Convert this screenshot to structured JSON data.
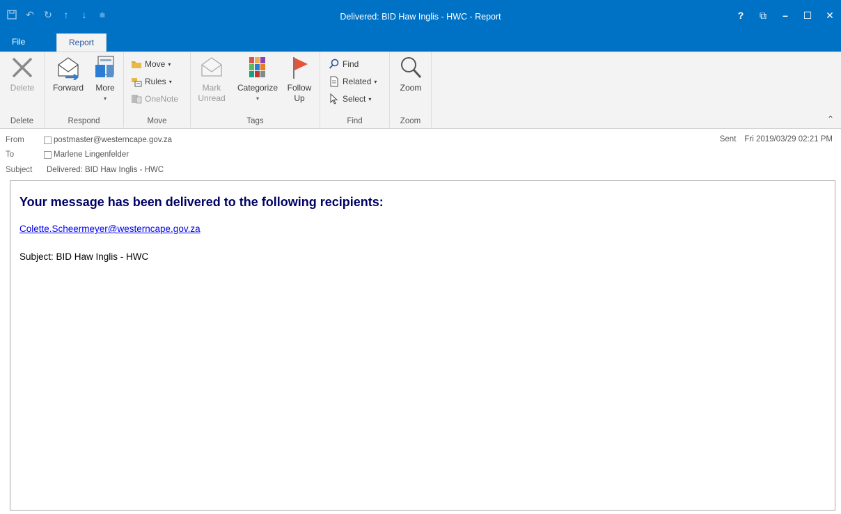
{
  "window": {
    "title": "Delivered: BID Haw Inglis - HWC - Report",
    "controls": [
      "?",
      "⧉",
      "–",
      "☐",
      "✕"
    ]
  },
  "qat": [
    "save-icon",
    "undo-icon",
    "redo-icon",
    "up-icon",
    "down-icon",
    "customize-icon"
  ],
  "tabs": {
    "file": "File",
    "report": "Report"
  },
  "ribbon": {
    "groups": {
      "delete": {
        "label": "Delete",
        "delete_btn": "Delete"
      },
      "respond": {
        "label": "Respond",
        "forward_btn": "Forward",
        "more_btn": "More"
      },
      "move": {
        "label": "Move",
        "move_btn": "Move",
        "rules_btn": "Rules",
        "onenote_btn": "OneNote"
      },
      "tags": {
        "label": "Tags",
        "mark_unread_btn": "Mark Unread",
        "categorize_btn": "Categorize",
        "follow_up_btn": "Follow Up"
      },
      "find": {
        "label": "Find",
        "find_btn": "Find",
        "related_btn": "Related",
        "select_btn": "Select"
      },
      "zoom": {
        "label": "Zoom",
        "zoom_btn": "Zoom"
      }
    }
  },
  "header": {
    "from_label": "From",
    "from_value": "postmaster@westerncape.gov.za",
    "to_label": "To",
    "to_value": "Marlene Lingenfelder",
    "subject_label": "Subject",
    "subject_value": "Delivered: BID Haw Inglis - HWC",
    "sent_label": "Sent",
    "sent_value": "Fri 2019/03/29 02:21 PM"
  },
  "body": {
    "heading": "Your message has been delivered to the following recipients:",
    "recipient": "Colette.Scheermeyer@westerncape.gov.za",
    "subject_line": "Subject: BID Haw Inglis - HWC"
  },
  "colors": {
    "title_bar": "#0072c6",
    "heading": "#000066",
    "link": "#0000ee"
  }
}
